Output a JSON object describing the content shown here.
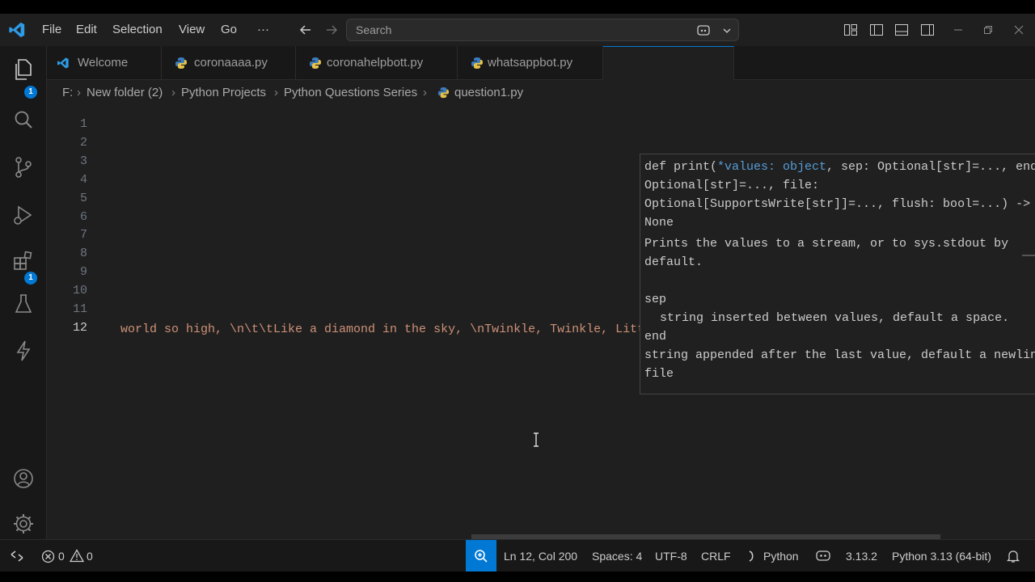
{
  "menu": [
    "File",
    "Edit",
    "Selection",
    "View",
    "Go",
    "···"
  ],
  "search": {
    "placeholder": "Search"
  },
  "activity_badges": {
    "explorer": "1",
    "extensions": "1"
  },
  "tabs": [
    "Welcome",
    "coronaaaa.py",
    "coronahelpbott.py",
    "whatsappbot.py"
  ],
  "breadcrumb": [
    "F:",
    "New folder (2)",
    "Python Projects",
    "Python Questions Series",
    "question1.py"
  ],
  "line_numbers": [
    "1",
    "2",
    "3",
    "4",
    "5",
    "6",
    "7",
    "8",
    "9",
    "10",
    "11",
    "12"
  ],
  "active_line": "12",
  "code_line12": "world so high, \\n\\t\\tLike a diamond in the sky, \\nTwinkle, Twinkle, Little Star, \\n\\t How I wonder what you ar",
  "code_line12_end": "\")",
  "hover": {
    "sig_a": "def print(",
    "sig_b": "*values: object",
    "sig_c": ", sep: Optional[str]=..., end: Optional[str]=..., file: Optional[SupportsWrite[str]]=..., flush: bool=...) -> None",
    "desc": "Prints the values to a stream, or to sys.stdout by default.",
    "sep_name": "sep",
    "sep_desc": "string inserted between values, default a space.",
    "end_name": "end",
    "end_desc": "string appended after the last value, default a newline.",
    "file_name": "file"
  },
  "status": {
    "errors": "0",
    "warnings": "0",
    "position": "Ln 12, Col 200",
    "spaces": "Spaces: 4",
    "encoding": "UTF-8",
    "eol": "CRLF",
    "language": "Python",
    "version": "3.13.2",
    "interpreter": "Python 3.13 (64-bit)"
  },
  "colors": {
    "accent": "#0078d4",
    "string": "#ce9178",
    "bracket": "#ffd700",
    "keyword": "#569cd6"
  }
}
